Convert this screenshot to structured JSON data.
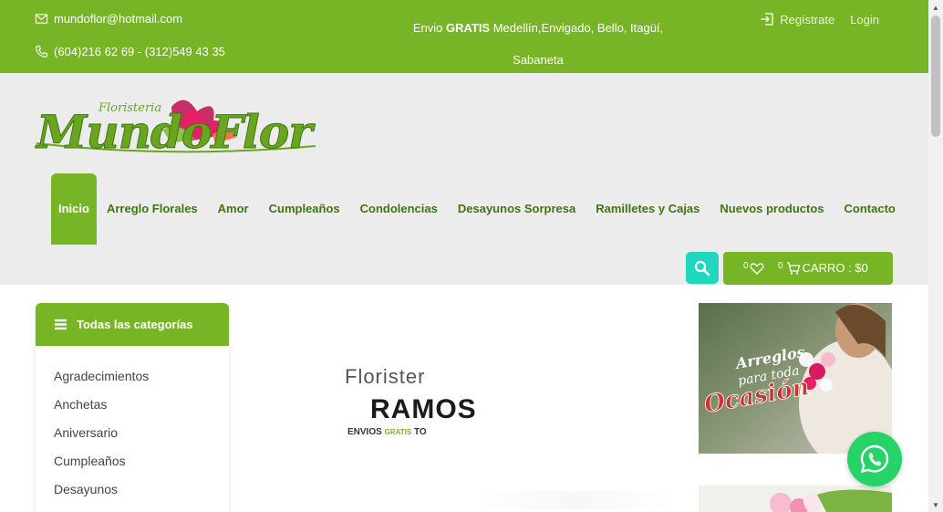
{
  "topbar": {
    "email": "mundoflor@hotmail.com",
    "phone": "(604)216 62 69 - (312)549 43 35",
    "promo_prefix": "Envio ",
    "promo_bold": "GRATIS",
    "promo_line1": " Medellín,Envigado, Bello, Itagüí,",
    "promo_line2": "Sabaneta",
    "register": "Regístrate",
    "login": "Login"
  },
  "logo": {
    "small_text": "Floristeria",
    "brand": "MundoFlor",
    "colors": {
      "green": "#6aa51f",
      "magenta": "#c2185b",
      "pink": "#e91e63"
    }
  },
  "nav": {
    "items": [
      {
        "label": "Inicio",
        "active": true
      },
      {
        "label": "Arreglo Florales"
      },
      {
        "label": "Amor"
      },
      {
        "label": "Cumpleaños"
      },
      {
        "label": "Condolencias"
      },
      {
        "label": "Desayunos Sorpresa"
      },
      {
        "label": "Ramilletes y Cajas"
      },
      {
        "label": "Nuevos productos"
      },
      {
        "label": "Contacto"
      }
    ]
  },
  "cart": {
    "wishlist_count": "0",
    "cart_count": "0",
    "label": "CARRO : $0"
  },
  "sidebar": {
    "title": "Todas las categorías",
    "items": [
      {
        "label": "Agradecimientos"
      },
      {
        "label": "Anchetas"
      },
      {
        "label": "Aniversario"
      },
      {
        "label": "Cumpleaños"
      },
      {
        "label": "Desayunos"
      }
    ]
  },
  "slider": {
    "line1": "Florister",
    "line2": "RAMOS Y",
    "line3_prefix": "ENVIOS ",
    "line3_green": "GRATIS",
    "line3_suffix": " TO"
  },
  "banner1": {
    "line1": "Arreglos",
    "line2": "para toda",
    "line3": "Ocasión"
  },
  "colors": {
    "brand_green": "#78b526",
    "dark_green": "#3e7612",
    "teal": "#1fd6bf",
    "whatsapp": "#25d366"
  }
}
